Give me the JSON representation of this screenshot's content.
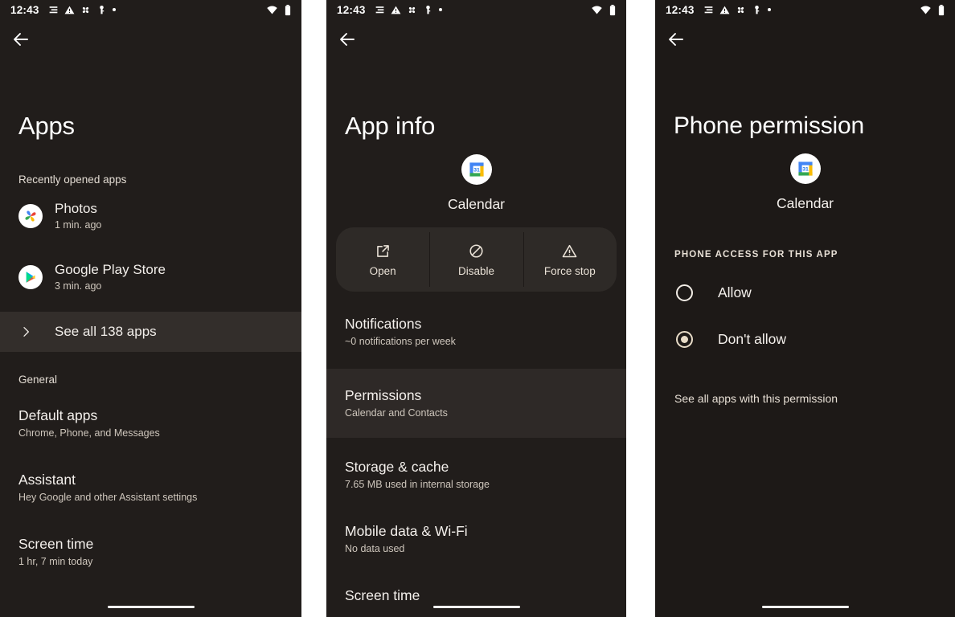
{
  "statusbar": {
    "time": "12:43",
    "icons": [
      "list-icon",
      "warning-triangle-icon",
      "pinwheel-icon",
      "key-icon",
      "dot-icon"
    ],
    "right_icons": [
      "wifi-icon",
      "battery-icon"
    ]
  },
  "colors": {
    "panel_bg": "#211d1b",
    "panel_bg_dark": "#1d1917",
    "highlight_row": "#332e2b",
    "accent_cream": "#e8e1d6",
    "radio_selected": "#e8dcc8",
    "text_primary": "#f4f0ec",
    "text_secondary": "#cec6bc"
  },
  "panel_apps": {
    "title": "Apps",
    "back_label": "Back",
    "recent_section_label": "Recently opened apps",
    "recent_apps": [
      {
        "name": "Photos",
        "subtitle": "1 min. ago",
        "icon": "google-photos-icon"
      },
      {
        "name": "Google Play Store",
        "subtitle": "3 min. ago",
        "icon": "google-play-icon"
      }
    ],
    "see_all_label": "See all 138 apps",
    "general_section_label": "General",
    "general_items": [
      {
        "title": "Default apps",
        "subtitle": "Chrome, Phone, and Messages"
      },
      {
        "title": "Assistant",
        "subtitle": "Hey Google and other Assistant settings"
      },
      {
        "title": "Screen time",
        "subtitle": "1 hr, 7 min today"
      }
    ]
  },
  "panel_appinfo": {
    "title": "App info",
    "back_label": "Back",
    "app_name": "Calendar",
    "app_icon": "google-calendar-icon",
    "actions": [
      {
        "label": "Open",
        "icon": "open-external-icon"
      },
      {
        "label": "Disable",
        "icon": "disable-circle-slash-icon"
      },
      {
        "label": "Force stop",
        "icon": "warning-triangle-icon"
      }
    ],
    "items": [
      {
        "title": "Notifications",
        "subtitle": "~0 notifications per week",
        "highlighted": false
      },
      {
        "title": "Permissions",
        "subtitle": "Calendar and Contacts",
        "highlighted": true
      },
      {
        "title": "Storage & cache",
        "subtitle": "7.65 MB used in internal storage",
        "highlighted": false
      },
      {
        "title": "Mobile data & Wi-Fi",
        "subtitle": "No data used",
        "highlighted": false
      },
      {
        "title": "Screen time",
        "subtitle": "",
        "highlighted": false
      }
    ]
  },
  "panel_permission": {
    "title": "Phone permission",
    "back_label": "Back",
    "app_name": "Calendar",
    "app_icon": "google-calendar-icon",
    "access_heading": "PHONE ACCESS FOR THIS APP",
    "options": [
      {
        "label": "Allow",
        "selected": false
      },
      {
        "label": "Don't allow",
        "selected": true
      }
    ],
    "footer_link": "See all apps with this permission"
  }
}
